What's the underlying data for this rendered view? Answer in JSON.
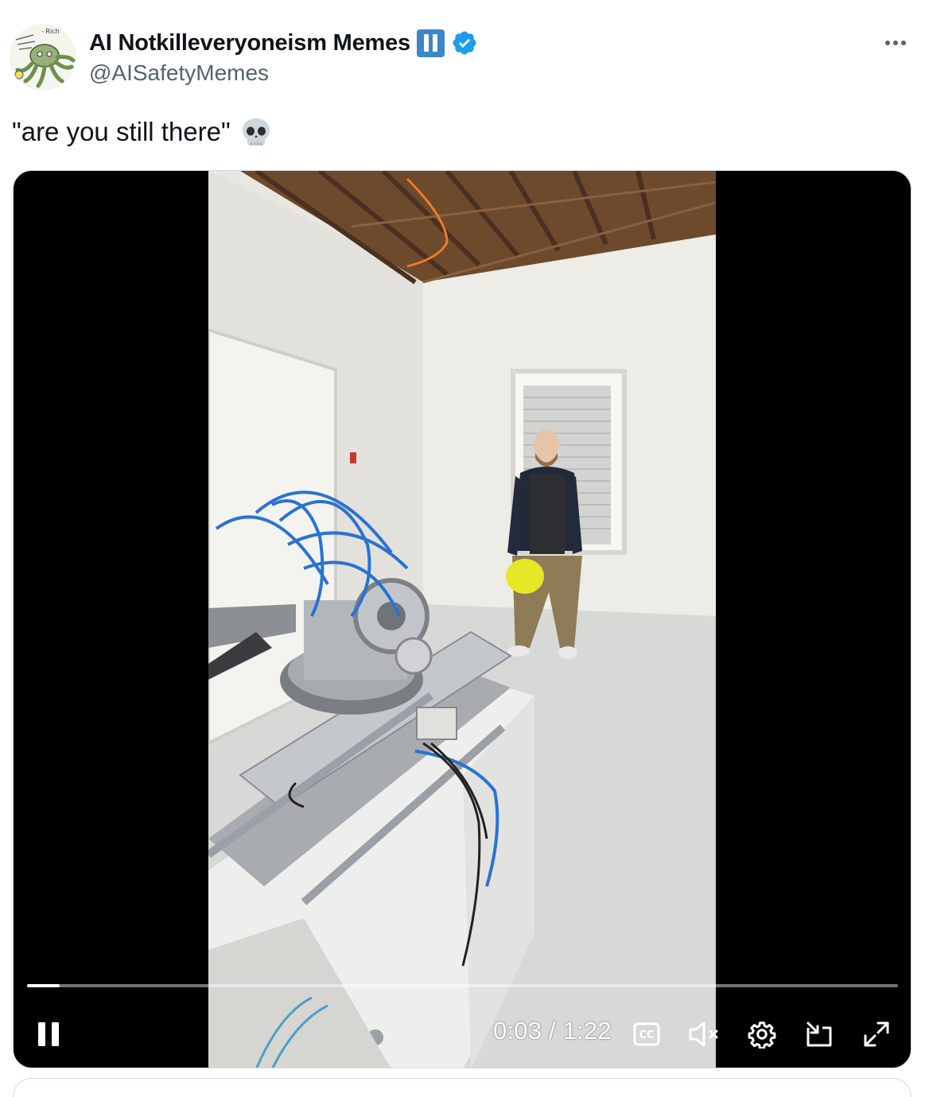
{
  "author": {
    "display_name": "AI Notkilleveryoneism Memes",
    "handle": "@AISafetyMemes",
    "avatar_icon": "octopus-doodle-avatar",
    "badges": [
      "pause-icon",
      "verified-badge-icon"
    ]
  },
  "menu": {
    "icon": "more-options-icon"
  },
  "tweet": {
    "text": "\"are you still there\"",
    "emoji": "skull-emoji"
  },
  "video": {
    "state": "playing",
    "elapsed": "0:03",
    "separator": "/",
    "duration": "1:22",
    "progress_fraction": 0.037,
    "controls": [
      "pause-icon",
      "captions-icon",
      "muted-speaker-icon",
      "settings-gear-icon",
      "picture-in-picture-icon",
      "fullscreen-icon"
    ]
  },
  "colors": {
    "verified_blue": "#1d9bf0",
    "pause_badge": "#3c87c8",
    "secondary_text": "#536471",
    "border": "#cfd9de"
  }
}
